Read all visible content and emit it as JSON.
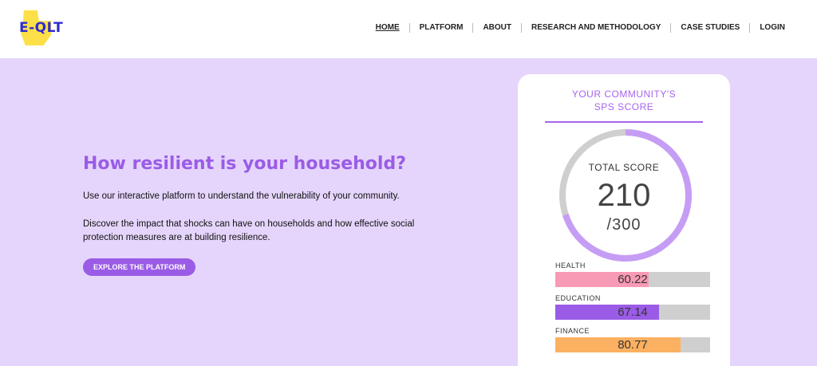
{
  "brand": {
    "logo_text": "E-QLT"
  },
  "nav": {
    "items": [
      {
        "label": "HOME",
        "active": true
      },
      {
        "label": "PLATFORM",
        "active": false
      },
      {
        "label": "ABOUT",
        "active": false
      },
      {
        "label": "RESEARCH AND METHODOLOGY",
        "active": false
      },
      {
        "label": "CASE STUDIES",
        "active": false
      },
      {
        "label": "LOGIN",
        "active": false
      }
    ]
  },
  "hero": {
    "title": "How resilient is your household?",
    "paragraph1": "Use our interactive platform to understand the vulnerability of your community.",
    "paragraph2": "Discover the impact that shocks can have on households and how effective social protection measures are at building resilience.",
    "cta_label": "EXPLORE THE PLATFORM"
  },
  "score_card": {
    "title_line1": "YOUR COMMUNITY'S",
    "title_line2": "SPS SCORE",
    "total_label": "TOTAL SCORE",
    "total_value": "210",
    "total_max": "/300",
    "total_fraction": 0.7,
    "ring_color": "#c69df5",
    "ring_track_color": "#cfcfcf",
    "bars": [
      {
        "label": "HEALTH",
        "value": "60.22",
        "fraction": 0.6022,
        "color": "#f899b5"
      },
      {
        "label": "EDUCATION",
        "value": "67.14",
        "fraction": 0.6714,
        "color": "#9a5ce6"
      },
      {
        "label": "FINANCE",
        "value": "80.77",
        "fraction": 0.8077,
        "color": "#fbb161"
      }
    ]
  },
  "colors": {
    "background": "#e5d5fc",
    "accent": "#9a5ce6",
    "header": "#ffffff"
  }
}
